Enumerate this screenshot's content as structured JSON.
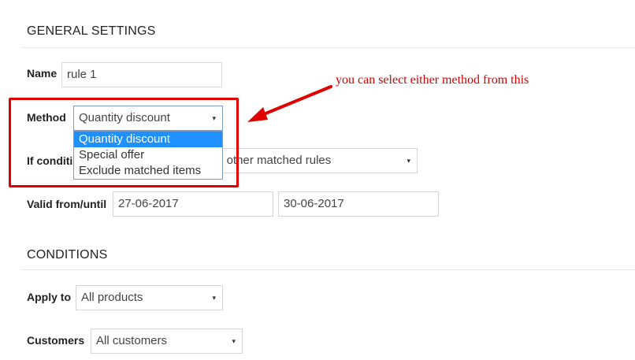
{
  "general": {
    "title": "GENERAL SETTINGS",
    "name_label": "Name",
    "name_value": "rule 1",
    "method_label": "Method",
    "method_selected": "Quantity discount",
    "method_options": [
      "Quantity discount",
      "Special offer",
      "Exclude matched items"
    ],
    "if_condition_label": "If conditi",
    "if_condition_value": "th other matched rules",
    "valid_label": "Valid from/until",
    "valid_from": "27-06-2017",
    "valid_until": "30-06-2017"
  },
  "conditions": {
    "title": "CONDITIONS",
    "apply_to_label": "Apply to",
    "apply_to_value": "All products",
    "customers_label": "Customers",
    "customers_value": "All customers"
  },
  "annotation": {
    "text": "you can select either method from this",
    "color": "#d40000"
  },
  "icons": {
    "dropdown_arrow": "▾"
  }
}
